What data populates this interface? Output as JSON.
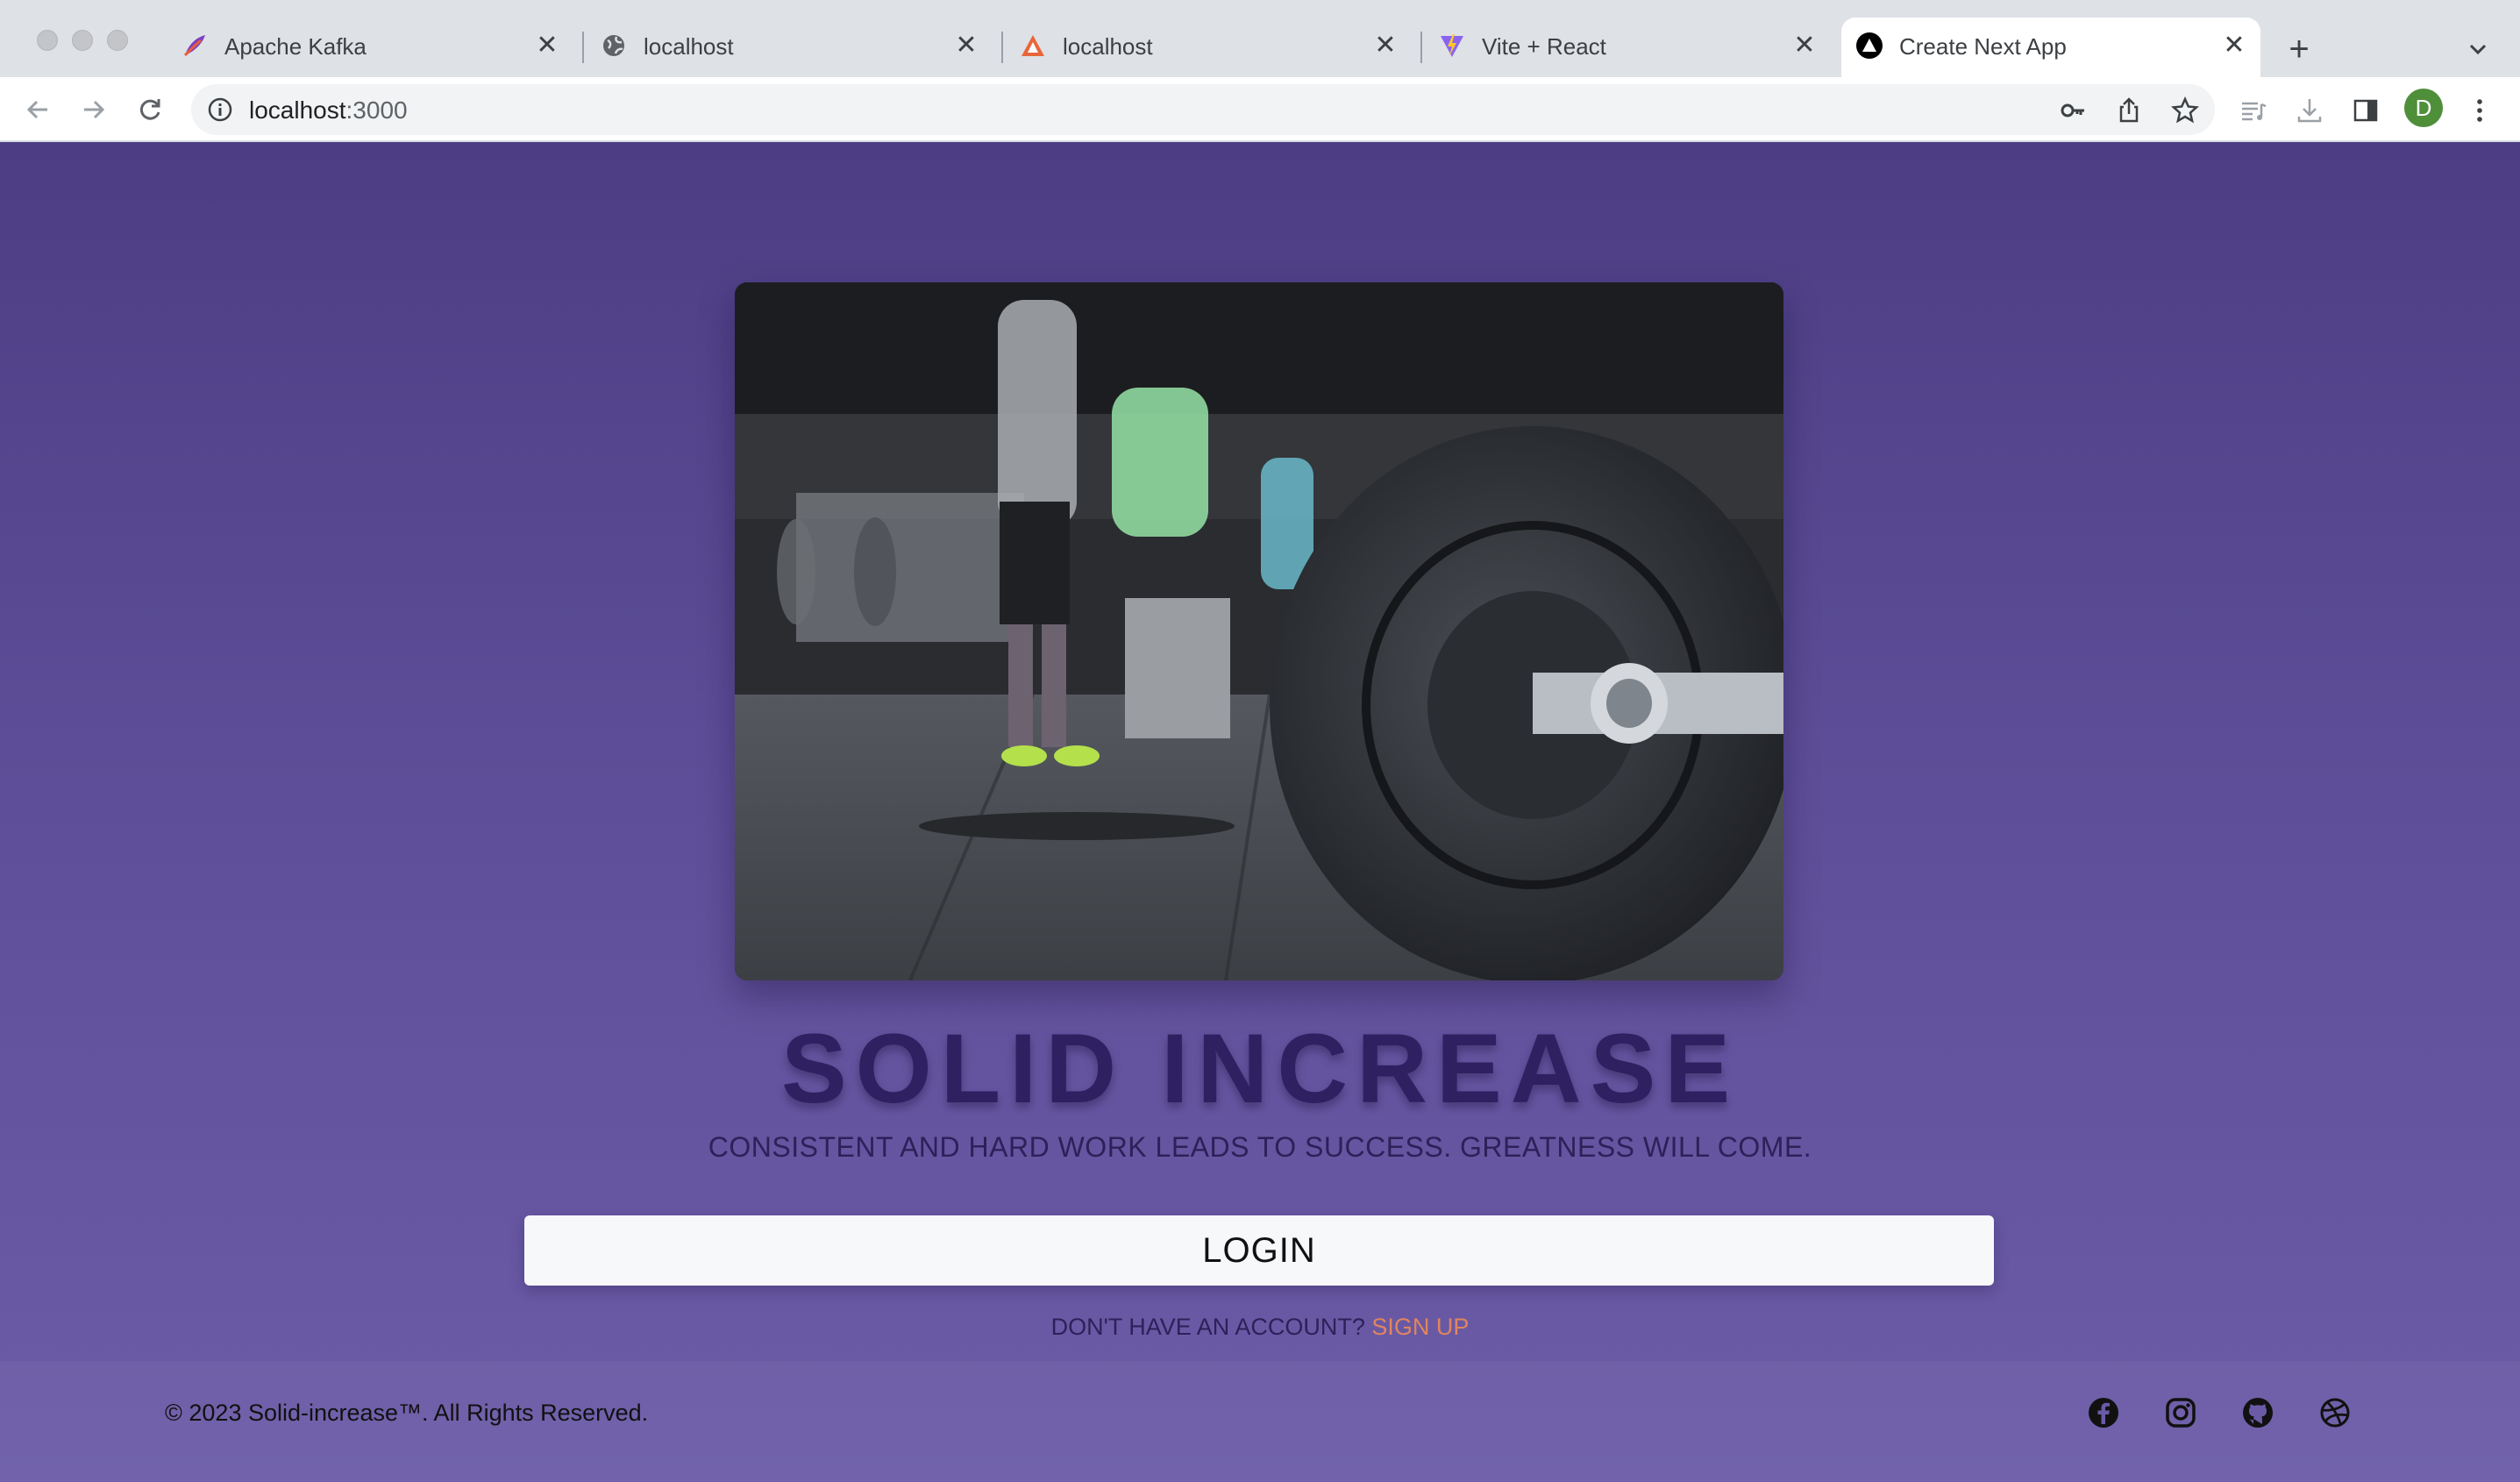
{
  "browser": {
    "tabs": [
      {
        "title": "Apache Kafka",
        "favicon": "kafka-feather-icon",
        "active": false
      },
      {
        "title": "localhost",
        "favicon": "globe-icon",
        "active": false
      },
      {
        "title": "localhost",
        "favicon": "triangle-logo-icon",
        "active": false
      },
      {
        "title": "Vite + React",
        "favicon": "vite-logo-icon",
        "active": false
      },
      {
        "title": "Create Next App",
        "favicon": "nextjs-logo-icon",
        "active": true
      }
    ],
    "new_tab_label": "+",
    "tab_close_label": "✕",
    "address": {
      "host": "localhost",
      "port": ":3000"
    },
    "profile_initial": "D",
    "profile_color": "#4f8f3a"
  },
  "page": {
    "hero_image_alt": "Gym floor with barbell plate",
    "title": "SOLID INCREASE",
    "subtitle": "CONSISTENT AND HARD WORK LEADS TO SUCCESS. GREATNESS WILL COME.",
    "login_label": "LOGIN",
    "signup_prompt": "DON'T HAVE AN ACCOUNT?",
    "signup_link": "SIGN UP",
    "footer": {
      "copyright": "© 2023 Solid-increase™. All Rights Reserved.",
      "social": [
        "facebook-icon",
        "instagram-icon",
        "github-icon",
        "dribbble-icon"
      ]
    }
  },
  "colors": {
    "page_bg_top": "#4c3d84",
    "page_bg_bottom": "#6c5ca8",
    "title": "#2e2061",
    "signup_link": "#e0855e",
    "login_bg": "#f7f8fa"
  }
}
